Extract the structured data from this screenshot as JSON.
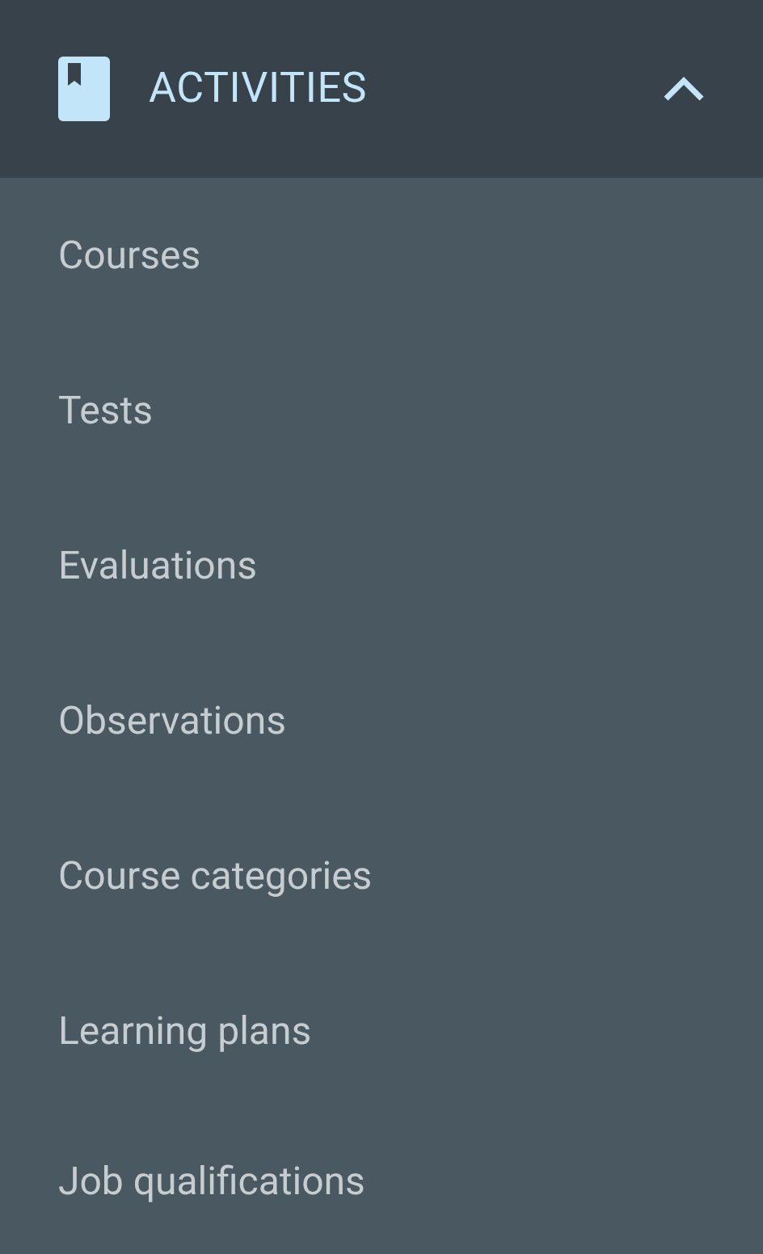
{
  "section": {
    "title": "ACTIVITIES",
    "expanded": true,
    "items": [
      {
        "label": "Courses"
      },
      {
        "label": "Tests"
      },
      {
        "label": "Evaluations"
      },
      {
        "label": "Observations"
      },
      {
        "label": "Course categories"
      },
      {
        "label": "Learning plans"
      },
      {
        "label": "Job qualifications"
      }
    ]
  }
}
